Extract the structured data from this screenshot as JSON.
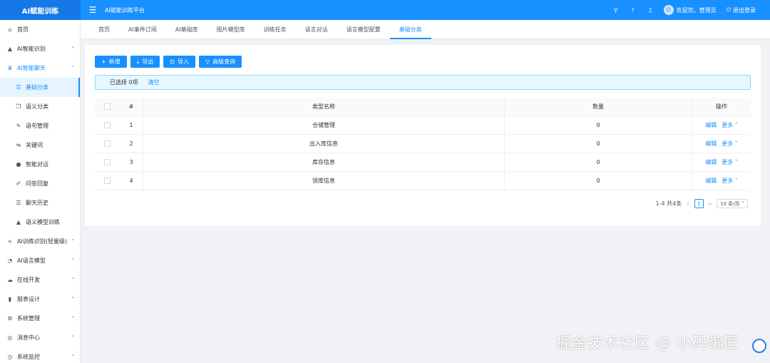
{
  "header": {
    "logo": "AI赋能训练",
    "app_title": "AI赋能训练平台",
    "welcome": "欢迎您，管理员",
    "logout": "退出登录",
    "icons": [
      "search-icon",
      "help-icon",
      "bell-icon",
      "avatar-icon",
      "logout-icon"
    ]
  },
  "sidebar": {
    "items": [
      {
        "label": "首页",
        "icon": "home-icon"
      },
      {
        "label": "AI智能识别",
        "icon": "warning-triangle-icon",
        "arrow": "˅"
      },
      {
        "label": "AI智能聊天",
        "icon": "chat-bot-icon",
        "arrow": "˄"
      },
      {
        "label": "基础分类",
        "icon": "list-icon"
      },
      {
        "label": "语义分类",
        "icon": "document-icon"
      },
      {
        "label": "语句管理",
        "icon": "edit-icon"
      },
      {
        "label": "关键词",
        "icon": "key-icon"
      },
      {
        "label": "智能对话",
        "icon": "wechat-icon"
      },
      {
        "label": "问答回复",
        "icon": "pen-icon"
      },
      {
        "label": "聊天历史",
        "icon": "history-list-icon"
      },
      {
        "label": "语义模型训练",
        "icon": "triangle-icon"
      },
      {
        "label": "AI训练识别(轻量级)",
        "icon": "share-icon",
        "arrow": "˅"
      },
      {
        "label": "AI语言模型",
        "icon": "chart-circle-icon",
        "arrow": "˅"
      },
      {
        "label": "在线开发",
        "icon": "cloud-icon",
        "arrow": "˅"
      },
      {
        "label": "报表设计",
        "icon": "bar-chart-icon",
        "arrow": "˅"
      },
      {
        "label": "系统管理",
        "icon": "settings-icon",
        "arrow": "˅"
      },
      {
        "label": "消息中心",
        "icon": "message-icon",
        "arrow": "˅"
      },
      {
        "label": "系统监控",
        "icon": "monitor-icon",
        "arrow": "˅"
      }
    ]
  },
  "tabs": [
    "首页",
    "AI事件订阅",
    "AI基础库",
    "图片模型库",
    "训练任务",
    "语言对话",
    "语言模型配置",
    "基础分类"
  ],
  "toolbar": {
    "add": "新增",
    "export": "导出",
    "import": "导入",
    "advanced_query": "高级查询"
  },
  "alert": {
    "selected": "已选择 0项",
    "clear": "清空"
  },
  "table": {
    "headers": [
      "#",
      "类型名称",
      "数量",
      "操作"
    ],
    "rows": [
      {
        "num": "1",
        "name": "仓储管理",
        "qty": "0",
        "edit": "编辑",
        "more": "更多"
      },
      {
        "num": "2",
        "name": "出入库信息",
        "qty": "0",
        "edit": "编辑",
        "more": "更多"
      },
      {
        "num": "3",
        "name": "库存信息",
        "qty": "0",
        "edit": "编辑",
        "more": "更多"
      },
      {
        "num": "4",
        "name": "领库信息",
        "qty": "0",
        "edit": "编辑",
        "more": "更多"
      }
    ]
  },
  "pagination": {
    "summary": "1-4 共4条",
    "current": "1",
    "page_size": "10 条/页"
  },
  "watermark": "掘金技术社区 @ 小码编匠",
  "colors": {
    "primary": "#1890ff",
    "header": "#1890ff",
    "logo_bg": "#1677e6"
  }
}
